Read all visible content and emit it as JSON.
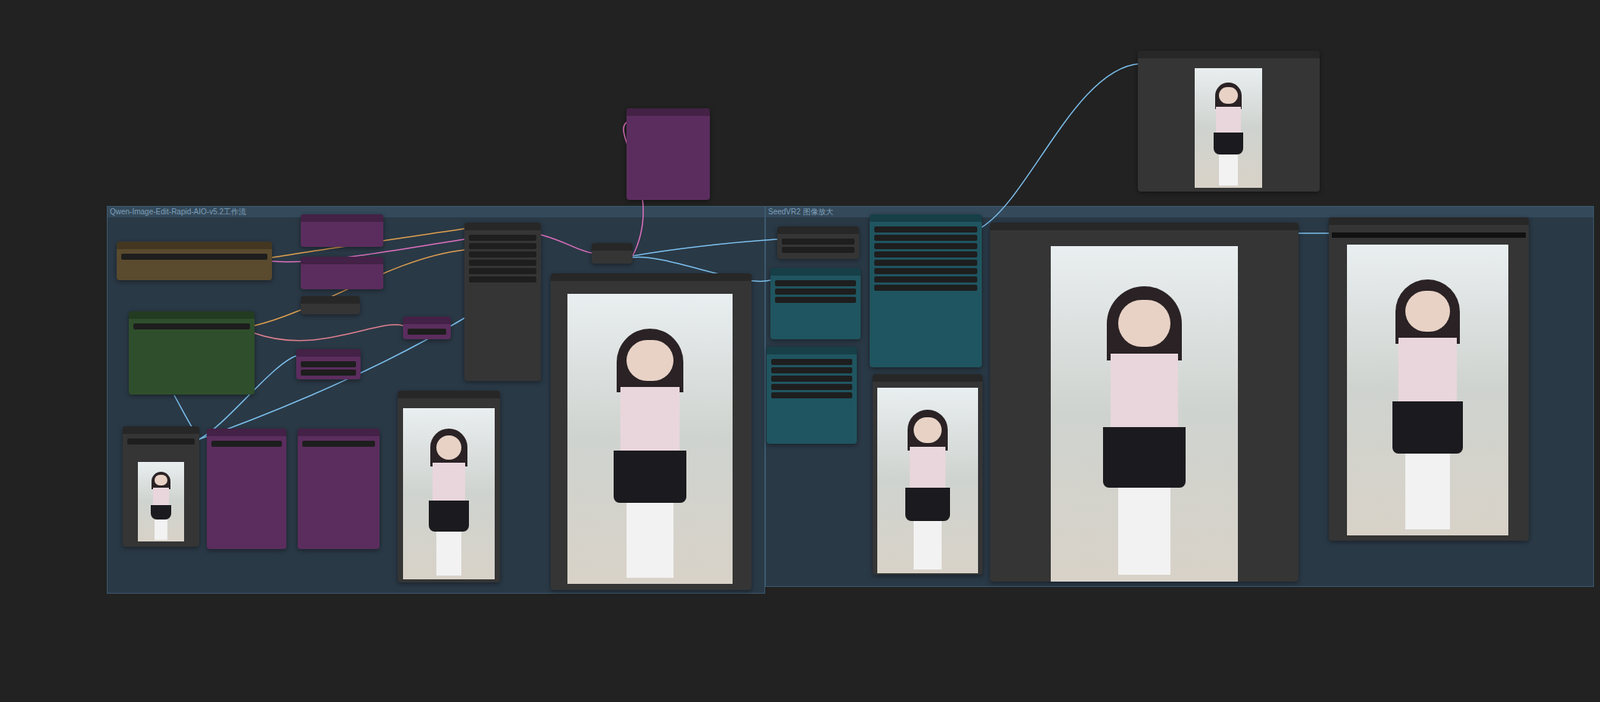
{
  "canvas": {
    "groups": [
      {
        "title": "Qwen-Image-Edit-Rapid-AIO-v5.2工作流"
      },
      {
        "title": "SeedVR2 图像放大"
      }
    ],
    "nodes": [
      {
        "kind": "widgets",
        "color": "#5a4a2e"
      },
      {
        "kind": "widgets",
        "color": "#5b2d5e"
      },
      {
        "kind": "widgets",
        "color": "#5b2d5e"
      },
      {
        "kind": "widgets",
        "color": "#353535"
      },
      {
        "kind": "widgets",
        "color": "#2f4f2c"
      },
      {
        "kind": "widgets",
        "color": "#5b2d5e"
      },
      {
        "kind": "widgets",
        "color": "#5b2d5e"
      },
      {
        "kind": "widgets",
        "color": "#353535"
      },
      {
        "kind": "widgets",
        "color": "#353535"
      },
      {
        "kind": "image",
        "color": "#353535"
      },
      {
        "kind": "widgets",
        "color": "#5b2d5e"
      },
      {
        "kind": "widgets",
        "color": "#5b2d5e"
      },
      {
        "kind": "image",
        "color": "#353535"
      },
      {
        "kind": "image",
        "color": "#353535"
      },
      {
        "kind": "widgets",
        "color": "#5b2d5e"
      },
      {
        "kind": "image",
        "color": "#353535"
      },
      {
        "kind": "widgets",
        "color": "#353535"
      },
      {
        "kind": "widgets",
        "color": "#1f5560"
      },
      {
        "kind": "widgets",
        "color": "#1f5560"
      },
      {
        "kind": "widgets",
        "color": "#1f5560"
      },
      {
        "kind": "image",
        "color": "#353535"
      },
      {
        "kind": "image",
        "color": "#353535"
      },
      {
        "kind": "image",
        "color": "#353535"
      }
    ]
  }
}
